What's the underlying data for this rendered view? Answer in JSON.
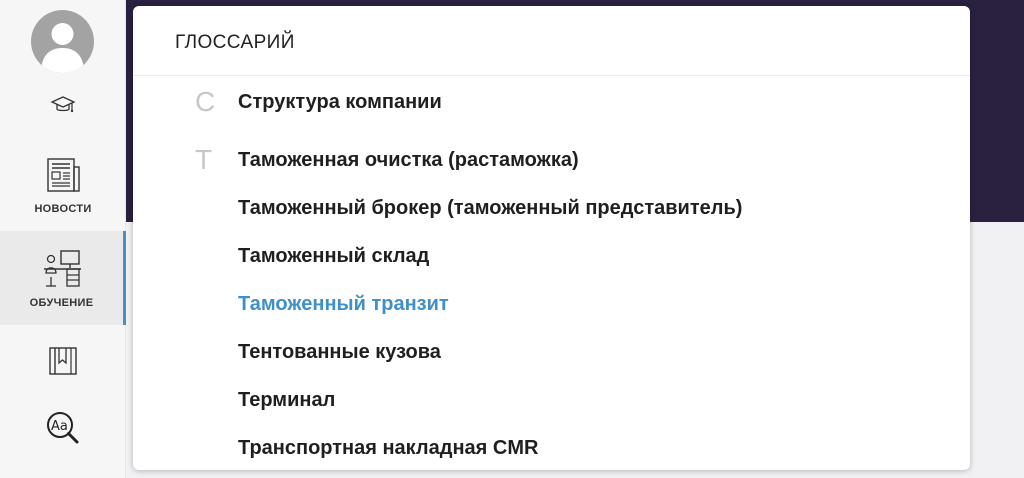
{
  "sidebar": {
    "items": [
      {
        "icon": "graduation-cap-icon",
        "label": ""
      },
      {
        "icon": "newspaper-icon",
        "label": "НОВОСТИ"
      },
      {
        "icon": "desk-icon",
        "label": "ОБУЧЕНИЕ"
      },
      {
        "icon": "bookmark-book-icon",
        "label": ""
      },
      {
        "icon": "dictionary-search-icon",
        "label": ""
      }
    ],
    "active_index": 2,
    "active_color": "#4a90c8"
  },
  "glossary": {
    "title": "ГЛОССАРИЙ",
    "groups": [
      {
        "letter": "С",
        "terms": [
          "Структура компании"
        ]
      },
      {
        "letter": "Т",
        "terms": [
          "Таможенная очистка (растаможка)",
          "Таможенный брокер (таможенный представитель)",
          "Таможенный склад",
          "Таможенный транзит",
          "Тентованные кузова",
          "Терминал",
          "Транспортная накладная CMR"
        ]
      }
    ],
    "highlighted_term": "Таможенный транзит",
    "highlight_color": "#3f8fc9"
  }
}
